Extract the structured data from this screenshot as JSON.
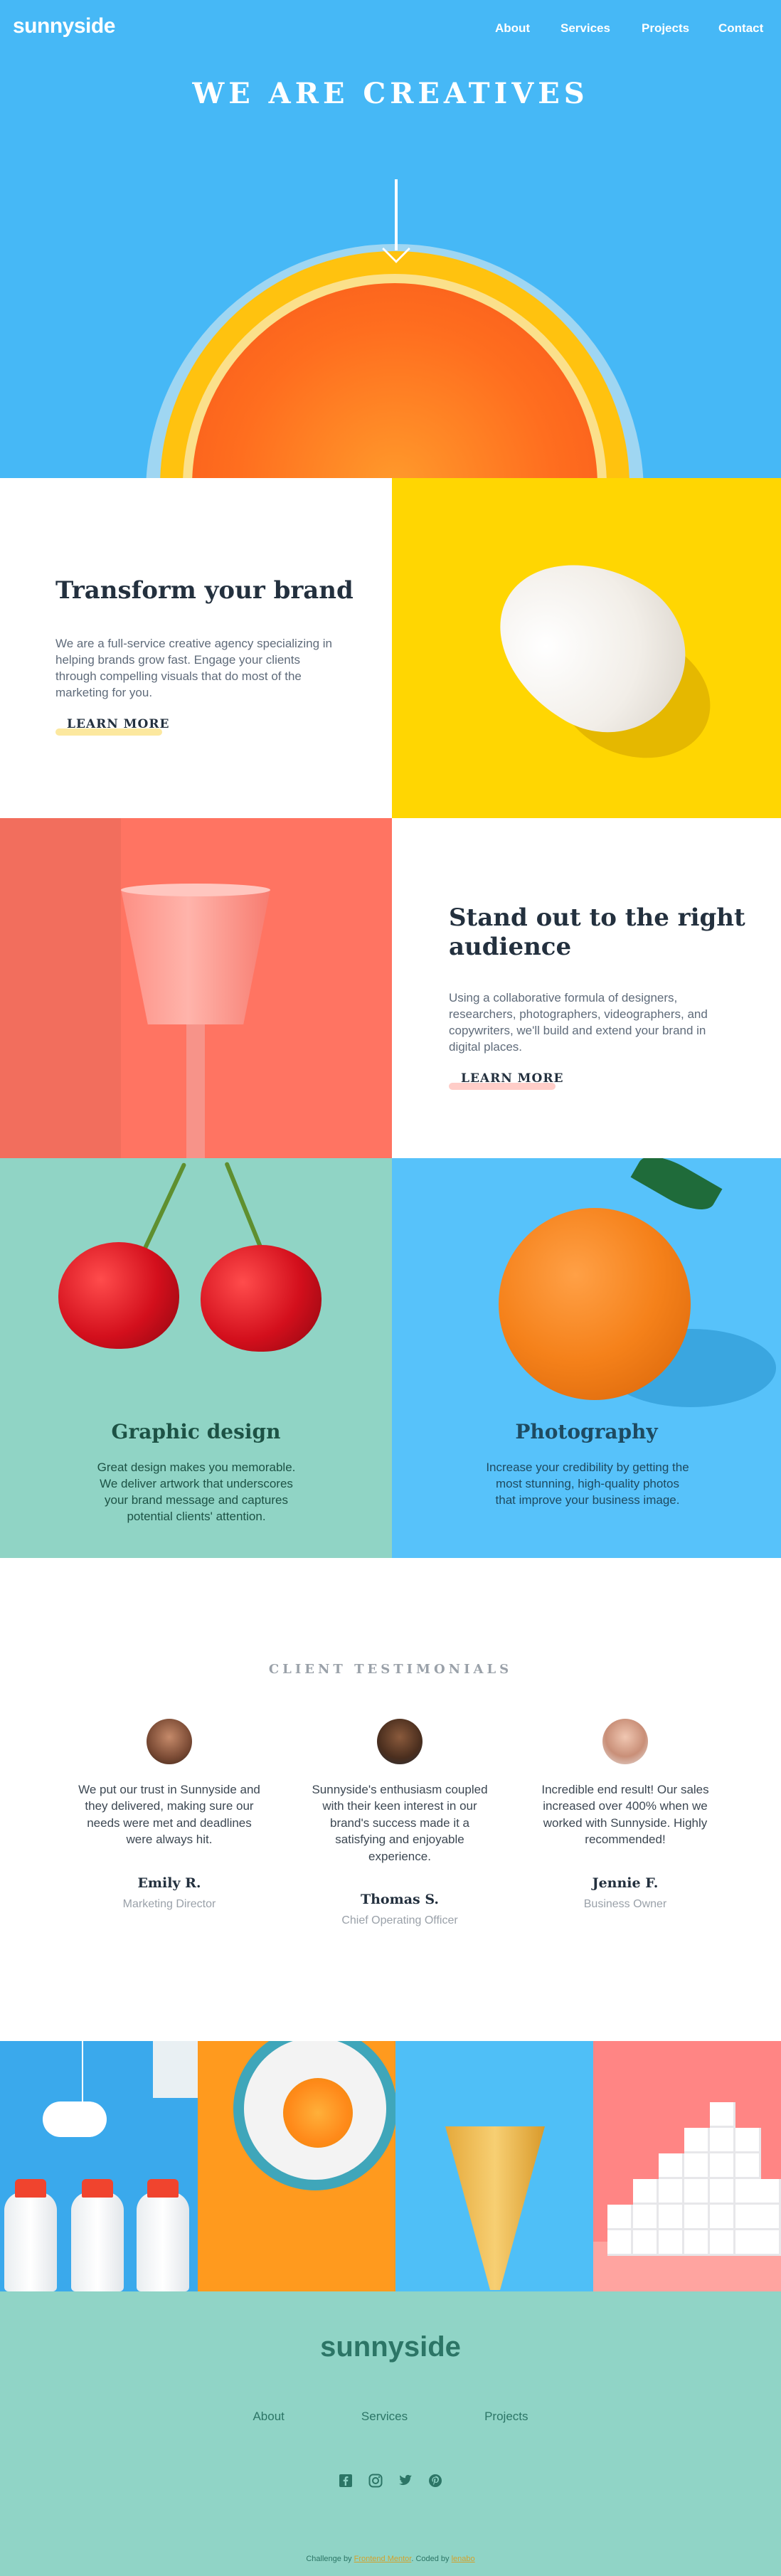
{
  "header": {
    "logo": "sunnyside",
    "nav": [
      "About",
      "Services",
      "Projects",
      "Contact"
    ]
  },
  "hero": {
    "title": "WE ARE CREATIVES"
  },
  "features": [
    {
      "title": "Transform your brand",
      "text": "We are a full-service creative agency specializing in helping brands grow fast. Engage your clients through compelling visuals that do most of the marketing for you.",
      "link": "LEARN MORE"
    },
    {
      "title": "Stand out to the right audience",
      "text": "Using a collaborative formula of designers, researchers, photographers, videographers, and copywriters, we'll build and extend your brand in digital places.",
      "link": "LEARN MORE"
    }
  ],
  "services": [
    {
      "title": "Graphic design",
      "text": "Great design makes you memorable. We deliver artwork that underscores your brand message and captures potential clients' attention."
    },
    {
      "title": "Photography",
      "text": "Increase your credibility by getting the most stunning, high-quality photos that improve your business image."
    }
  ],
  "testimonials": {
    "heading": "CLIENT TESTIMONIALS",
    "items": [
      {
        "quote": "We put our trust in Sunnyside and they delivered, making sure our needs were met and deadlines were always hit.",
        "name": "Emily R.",
        "role": "Marketing Director"
      },
      {
        "quote": "Sunnyside's enthusiasm coupled with their keen interest in our brand's success made it a satisfying and enjoyable experience.",
        "name": "Thomas S.",
        "role": "Chief Operating Officer"
      },
      {
        "quote": "Incredible end result! Our sales increased over 400% when we worked with Sunnyside. Highly recommended!",
        "name": "Jennie F.",
        "role": "Business Owner"
      }
    ]
  },
  "footer": {
    "logo": "sunnyside",
    "links": [
      "About",
      "Services",
      "Projects"
    ],
    "social_icons": [
      "facebook-icon",
      "instagram-icon",
      "twitter-icon",
      "pinterest-icon"
    ],
    "credit_prefix": "Challenge by",
    "credit_fm": "Frontend Mentor",
    "credit_mid": ". Coded by",
    "credit_author": "lenabo"
  },
  "colors": {
    "hero_blue": "#46b8f6",
    "yellow": "#ffd602",
    "coral": "#ff7462",
    "mint": "#90d4c5",
    "sky": "#57c2fa",
    "dark_green_text": "#1d5245",
    "dark_blue_text": "#1e4a60",
    "footer_green": "#2c7566"
  }
}
